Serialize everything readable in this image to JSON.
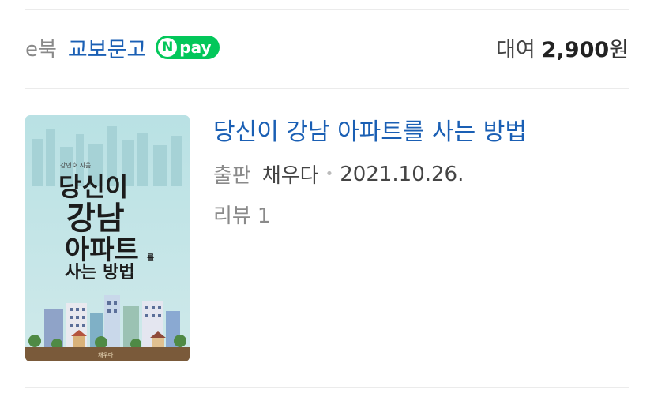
{
  "store": {
    "ebook_label": "e북",
    "name": "교보문고",
    "npay_n": "N",
    "npay_text": "pay",
    "price_label": "대여",
    "price_amount": "2,900",
    "price_unit": "원"
  },
  "book": {
    "title": "당신이 강남 아파트를 사는 방법",
    "publisher_label": "출판",
    "publisher": "채우다",
    "date": "2021.10.26.",
    "review_label": "리뷰",
    "review_count": "1",
    "cover": {
      "author": "강민호 지음",
      "title_line1": "당신이",
      "title_line2": "강남",
      "title_line3": "아파트",
      "title_line3_small": "를",
      "title_line4": "사는 방법",
      "publisher_mark": "채우다"
    }
  },
  "colors": {
    "link": "#1a5fb4",
    "npay_green": "#03c75a",
    "cover_sky": "#b7dfe3",
    "cover_ground": "#7a5a3a"
  }
}
